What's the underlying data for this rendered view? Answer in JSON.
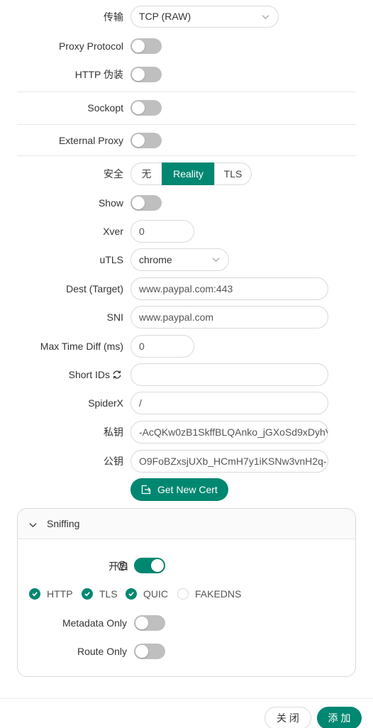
{
  "form": {
    "transport": {
      "label": "传输",
      "value": "TCP (RAW)"
    },
    "proxy_protocol": {
      "label": "Proxy Protocol",
      "on": false
    },
    "http_camouflage": {
      "label": "HTTP 伪装",
      "on": false
    },
    "sockopt": {
      "label": "Sockopt",
      "on": false
    },
    "external_proxy": {
      "label": "External Proxy",
      "on": false
    },
    "security": {
      "label": "安全",
      "options": [
        "无",
        "Reality",
        "TLS"
      ],
      "selected": "Reality"
    },
    "show": {
      "label": "Show",
      "on": false
    },
    "xver": {
      "label": "Xver",
      "value": "0"
    },
    "utls": {
      "label": "uTLS",
      "value": "chrome"
    },
    "dest": {
      "label": "Dest (Target)",
      "value": "www.paypal.com:443"
    },
    "sni": {
      "label": "SNI",
      "value": "www.paypal.com"
    },
    "max_time_diff": {
      "label": "Max Time Diff (ms)",
      "value": "0"
    },
    "short_ids": {
      "label": "Short IDs",
      "value": ""
    },
    "spiderx": {
      "label": "SpiderX",
      "value": "/"
    },
    "private_key": {
      "label": "私钥",
      "value": "-AcQKw0zB1SkffBLQAnko_jGXoSd9xDyhV"
    },
    "public_key": {
      "label": "公钥",
      "value": "O9FoBZxsjUXb_HCmH7y1iKSNw3vnH2q-"
    },
    "get_new_cert": {
      "label": "Get New Cert"
    }
  },
  "sniffing": {
    "title": "Sniffing",
    "enable_label": "开启",
    "enabled": true,
    "protocols": [
      {
        "label": "HTTP",
        "checked": true
      },
      {
        "label": "TLS",
        "checked": true
      },
      {
        "label": "QUIC",
        "checked": true
      },
      {
        "label": "FAKEDNS",
        "checked": false
      }
    ],
    "metadata_only": {
      "label": "Metadata Only",
      "on": false
    },
    "route_only": {
      "label": "Route Only",
      "on": false
    }
  },
  "footer": {
    "close_label": "关 闭",
    "add_label": "添 加"
  },
  "colors": {
    "accent": "#008771",
    "switch_off": "#bfbfbf",
    "border": "#d9d9d9"
  },
  "icons": {
    "select_arrow": "chevron-down-icon",
    "short_ids_refresh": "sync-icon",
    "cert": "export-icon",
    "collapse": "chevron-down-icon",
    "help": "question-circle-icon",
    "check": "check-icon"
  }
}
